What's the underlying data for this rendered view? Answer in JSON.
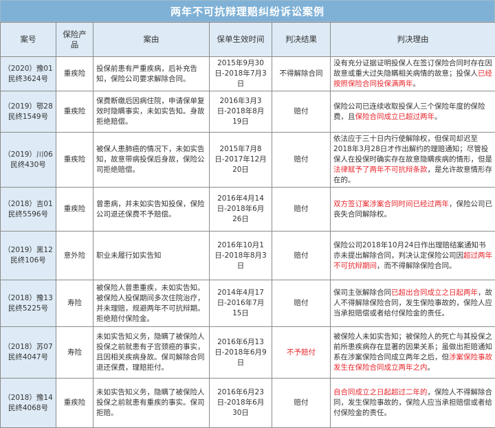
{
  "title": "两年不可抗辩理赔纠纷诉讼案例",
  "headers": [
    "案号",
    "保险产品",
    "案由",
    "保单生效时间",
    "判决结果",
    "判决理由"
  ],
  "colors": {
    "title_bg": "#7fb1d6",
    "header_bg": "#deebf6",
    "highlight": "#e8262c"
  },
  "rows": [
    {
      "case": "（2020）豫01民终3624号",
      "product": "重疾险",
      "cause": "投保前患有严重疾病，后补充告知，保险公司要求解除合同。",
      "period": "2015年9月30日-2018年7月3日",
      "result": "不得解除合同",
      "result_red": false,
      "reason": [
        {
          "t": "没有充分证据证明投保人在签订保险合同时存在因故意或重大过失隐瞒相关病情的故意；投保人",
          "r": false
        },
        {
          "t": "已经按照保险合同投保满两年",
          "r": true
        },
        {
          "t": "。",
          "r": false
        }
      ]
    },
    {
      "case": "（2019）鄂28民终1549号",
      "product": "重疾险",
      "cause": "保费断缴后因病住院，申请保单复效时隐瞒事实，未如实告知。身故拒绝赔偿。",
      "period": "2016年3月3日-2018年8月19日",
      "result": "赔付",
      "result_red": false,
      "reason": [
        {
          "t": "保险公司已连续收取投保人三个保险年度的保险费，且",
          "r": false
        },
        {
          "t": "保险合同成立已超过两年",
          "r": true
        },
        {
          "t": "。",
          "r": false
        }
      ]
    },
    {
      "case": "（2019）川06民终430号",
      "product": "重疾险",
      "cause": "被保人患肺癌的情况下，未如实告知，故意带病投保后身故，保险公司拒绝赔偿。",
      "period": "2015年7月8日-2017年12月20日",
      "result": "赔付",
      "result_red": false,
      "reason": [
        {
          "t": "依法应于三十日内行使解除权，但保司却迟至2018年3月28日才作出解约的理赔通知；尽管投保人在投保时确实存在故意隐瞒疾病的情形，但是",
          "r": false
        },
        {
          "t": "法律赋予了两年不可抗辩条款",
          "r": true
        },
        {
          "t": "，是允许故意情形存在的。",
          "r": false
        }
      ]
    },
    {
      "case": "（2018）吉01民终5596号",
      "product": "重疾险",
      "cause": "曾患病，并未如实告知投保，保险公司退还保费不予赔偿。",
      "period": "2016年4月14日-2018年6月26日",
      "result": "赔付",
      "result_red": false,
      "reason": [
        {
          "t": "双方签订案涉案合同时间已经过两年",
          "r": true
        },
        {
          "t": "，保险公司已丧失合同解除权。",
          "r": false
        }
      ]
    },
    {
      "case": "（2019）黑12民终106号",
      "product": "意外险",
      "cause": "职业未履行如实告知",
      "period": "2016年10月1日-2018年8月3日",
      "result": "赔付",
      "result_red": false,
      "reason": [
        {
          "t": "保险公司2018年10月24日作出理赔结案通知书亦未提出解除合同，判决认定保险公司因",
          "r": false
        },
        {
          "t": "超过两年不可抗辩期间",
          "r": true
        },
        {
          "t": "，而不得解除保险合同。",
          "r": false
        }
      ]
    },
    {
      "case": "（2018）豫13民终5225号",
      "product": "寿险",
      "cause": "被保险人曾患重疾，未如实告知。被保险人投保期间多次住院治疗，并未理赔，规避两年不可抗辩期。拒绝赔付保险金。",
      "period": "2014年4月17日-2016年7月15日",
      "result": "赔付",
      "result_red": false,
      "reason": [
        {
          "t": "保司主张解除合同",
          "r": false
        },
        {
          "t": "已超出合同成立之日起两年",
          "r": true
        },
        {
          "t": "，故人不得解除保险合同，发生保险事故的，保险人应当承担赔偿或者给付保险金的责任。",
          "r": false
        }
      ]
    },
    {
      "case": "（2018）苏07民终4047号",
      "product": "寿险",
      "cause": "未如实告知义务，隐瞒了被保险人投保之前就患有子宫颈癌的事实，且因相关疾病身故。保司解除合同退还保费，理赔拒付。",
      "period": "2016年6月13日-2018年6月9日",
      "result": "不予赔付",
      "result_red": true,
      "reason": [
        {
          "t": "被保险人未如实告知；被保险人的死亡与其投保之前所患疾病存在显著的因果关系；虽做出拒赔通知系在涉案保险合同成立两年之后，但",
          "r": false
        },
        {
          "t": "涉案保险事故发生在保险合同成立两年之内",
          "r": true
        },
        {
          "t": "。",
          "r": false
        }
      ]
    },
    {
      "case": "（2018）豫14民终4068号",
      "product": "重疾险",
      "cause": "未如实告知义务，隐瞒了被保险人投保之前就患有重疾的事实。保司拒赔。",
      "period": "2016年6月23日-2018年6月30日",
      "result": "赔付",
      "result_red": false,
      "reason": [
        {
          "t": "自合同成立之日起超过二年的",
          "r": true
        },
        {
          "t": "，保险人不得解除合同，发生保险事故的，保险人应当承担赔偿或者给付保险金的责任。",
          "r": false
        }
      ]
    }
  ]
}
